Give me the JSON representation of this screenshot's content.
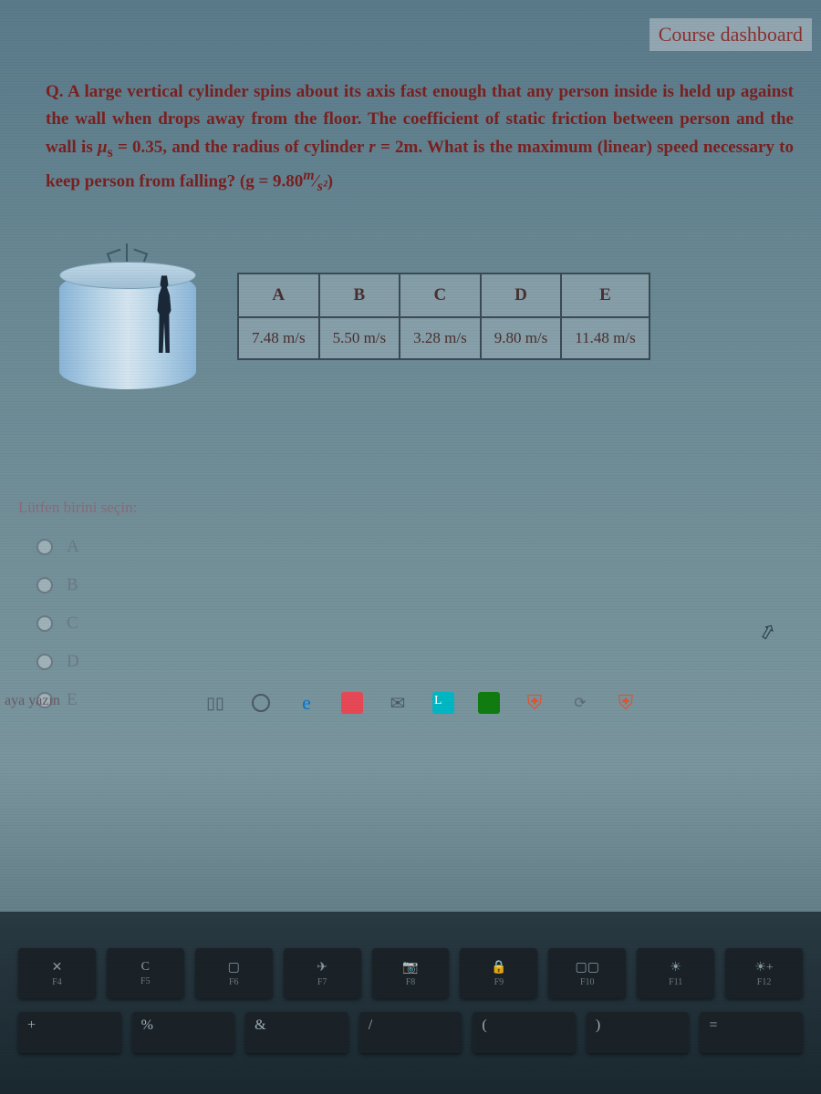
{
  "header": {
    "dashboard_link": "Course dashboard"
  },
  "question": {
    "text_parts": {
      "p1": "Q. A large vertical cylinder spins about its axis fast enough that any person inside is held up against the wall when drops away from the floor. The coefficient of static friction between person and the wall is ",
      "p2": "μ",
      "p3": "s",
      "p4": " = 0.35, and the radius of cylinder ",
      "p5": "r",
      "p6": " = 2m. What is the maximum (linear) speed necessary to keep person from falling? (g = 9.80",
      "p7": "m",
      "p8": "s²",
      "p9": ")"
    }
  },
  "table": {
    "headers": [
      "A",
      "B",
      "C",
      "D",
      "E"
    ],
    "values": [
      "7.48 m/s",
      "5.50 m/s",
      "3.28 m/s",
      "9.80 m/s",
      "11.48 m/s"
    ]
  },
  "options": {
    "prompt": "Lütfen birini seçin:",
    "items": [
      "A",
      "B",
      "C",
      "D",
      "E"
    ]
  },
  "search": {
    "text": "aya yazın"
  },
  "keyboard": {
    "fn_keys": [
      {
        "icon": "✕",
        "label": "F4"
      },
      {
        "icon": "C",
        "label": "F5"
      },
      {
        "icon": "▢",
        "label": "F6"
      },
      {
        "icon": "✈",
        "label": "F7"
      },
      {
        "icon": "📷",
        "label": "F8"
      },
      {
        "icon": "🔒",
        "label": "F9"
      },
      {
        "icon": "▢▢",
        "label": "F10"
      },
      {
        "icon": "☀",
        "label": "F11"
      },
      {
        "icon": "☀+",
        "label": "F12"
      }
    ],
    "num_keys": [
      "+",
      "%",
      "&",
      "/",
      "(",
      ")",
      "="
    ]
  }
}
